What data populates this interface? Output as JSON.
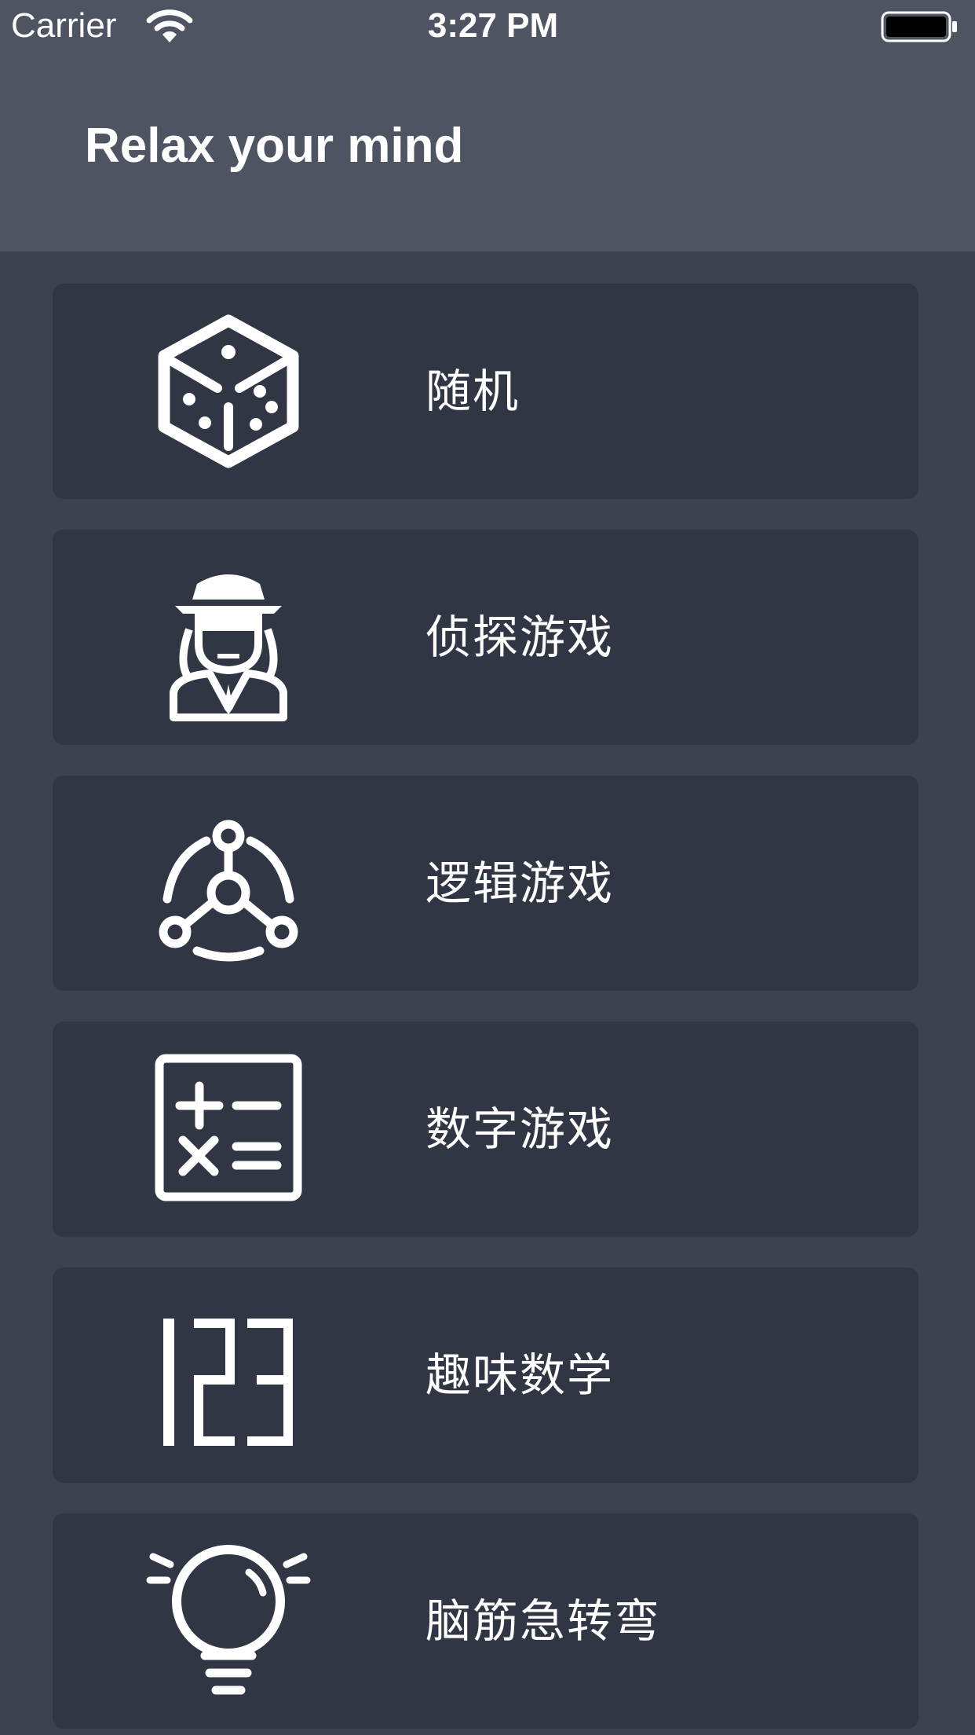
{
  "status_bar": {
    "carrier": "Carrier",
    "time": "3:27 PM",
    "icons": [
      "wifi-icon",
      "battery-icon"
    ]
  },
  "header": {
    "title": "Relax your mind"
  },
  "menu": {
    "items": [
      {
        "label": "随机",
        "icon": "dice-icon"
      },
      {
        "label": "侦探游戏",
        "icon": "detective-icon"
      },
      {
        "label": "逻辑游戏",
        "icon": "logic-network-icon"
      },
      {
        "label": "数字游戏",
        "icon": "calculator-icon"
      },
      {
        "label": "趣味数学",
        "icon": "digits-123-icon"
      },
      {
        "label": "脑筋急转弯",
        "icon": "lightbulb-icon"
      }
    ]
  },
  "colors": {
    "header_background": "#4f5462",
    "page_background": "#3c4250",
    "card_background": "#313644",
    "text": "#ffffff"
  }
}
